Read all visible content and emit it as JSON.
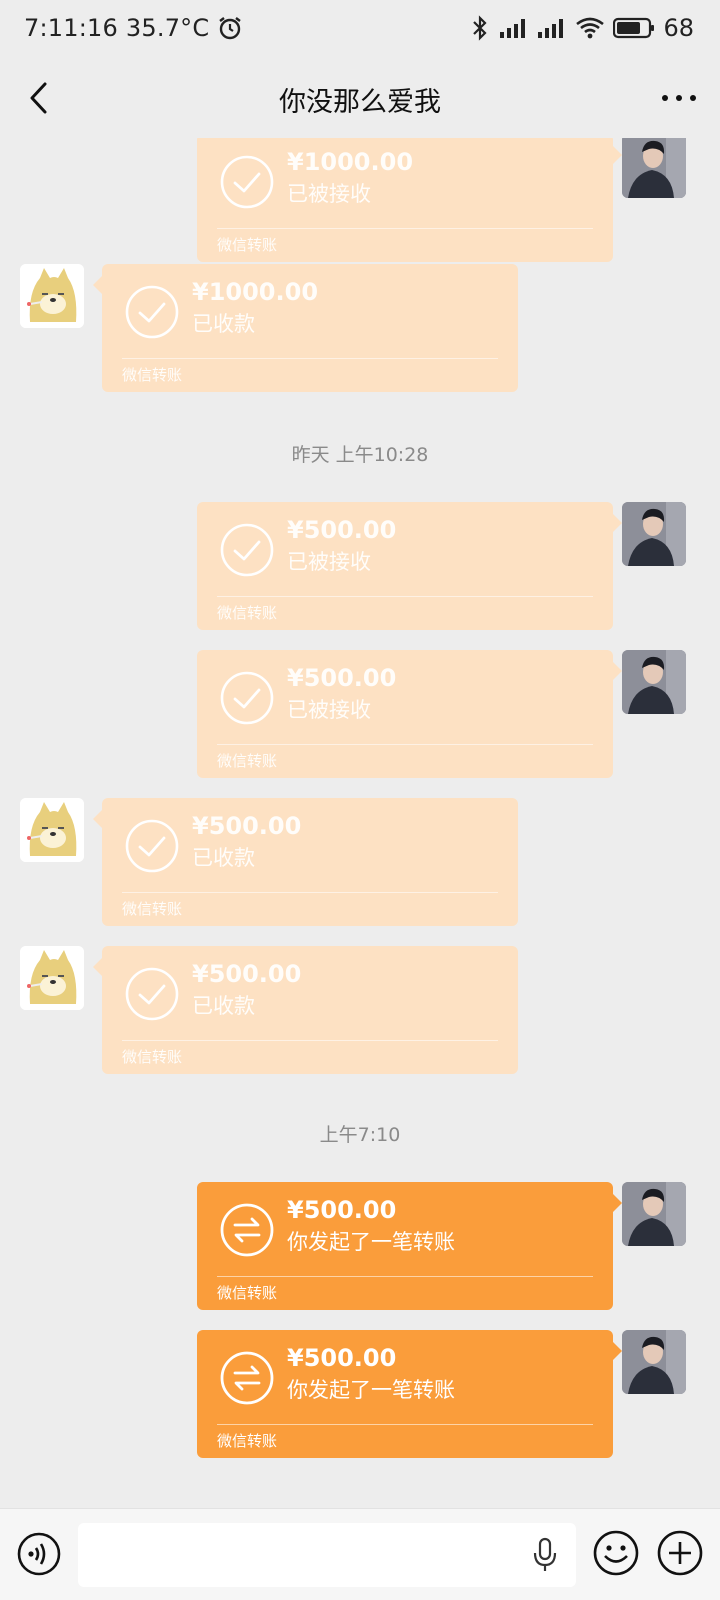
{
  "status_bar": {
    "time": "7:11:16",
    "temperature": "35.7°C",
    "battery": "68",
    "icons": [
      "alarm-icon",
      "bluetooth-icon",
      "signal-icon",
      "wifi-icon",
      "battery-icon"
    ]
  },
  "nav": {
    "title": "你没那么爱我",
    "back_icon": "chevron-left-icon",
    "more_icon": "more-dots-icon"
  },
  "messages": [
    {
      "side": "right",
      "amount": "¥1000.00",
      "status": "已被接收",
      "label": "微信转账",
      "state": "received"
    },
    {
      "side": "left",
      "amount": "¥1000.00",
      "status": "已收款",
      "label": "微信转账",
      "state": "received"
    },
    {
      "timestamp": "昨天 上午10:28"
    },
    {
      "side": "right",
      "amount": "¥500.00",
      "status": "已被接收",
      "label": "微信转账",
      "state": "received"
    },
    {
      "side": "right",
      "amount": "¥500.00",
      "status": "已被接收",
      "label": "微信转账",
      "state": "received"
    },
    {
      "side": "left",
      "amount": "¥500.00",
      "status": "已收款",
      "label": "微信转账",
      "state": "received"
    },
    {
      "side": "left",
      "amount": "¥500.00",
      "status": "已收款",
      "label": "微信转账",
      "state": "received"
    },
    {
      "timestamp": "上午7:10"
    },
    {
      "side": "right",
      "amount": "¥500.00",
      "status": "你发起了一笔转账",
      "label": "微信转账",
      "state": "pending"
    },
    {
      "side": "right",
      "amount": "¥500.00",
      "status": "你发起了一笔转账",
      "label": "微信转账",
      "state": "pending"
    }
  ],
  "input_bar": {
    "value": "",
    "icons": [
      "voice-icon",
      "mic-icon",
      "emoji-icon",
      "plus-icon"
    ]
  },
  "colors": {
    "bubble_pending": "#fa9d3b",
    "bubble_received": "#fde1c3",
    "background": "#ededed"
  }
}
